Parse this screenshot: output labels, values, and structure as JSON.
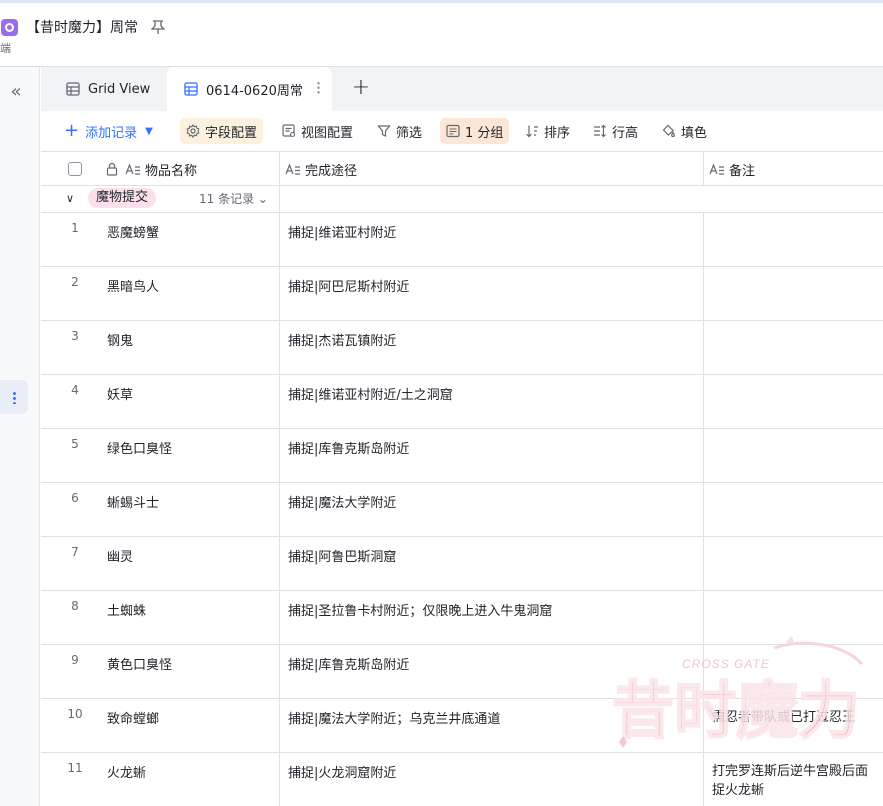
{
  "app": {
    "title": "【昔时魔力】周常",
    "subtitle": "端"
  },
  "tabs": [
    {
      "label": "Grid View",
      "active": false
    },
    {
      "label": "0614-0620周常",
      "active": true
    }
  ],
  "toolbar": {
    "add_record": "添加记录",
    "field_config": "字段配置",
    "view_config": "视图配置",
    "filter": "筛选",
    "group": "1 分组",
    "sort": "排序",
    "row_height": "行高",
    "fill_color": "填色"
  },
  "columns": {
    "name": "物品名称",
    "path": "完成途径",
    "note": "备注"
  },
  "group": {
    "label": "魔物提交",
    "count": "11 条记录"
  },
  "rows": [
    {
      "num": "1",
      "name": "恶魔螃蟹",
      "path": "捕捉|维诺亚村附近",
      "note": ""
    },
    {
      "num": "2",
      "name": "黑暗鸟人",
      "path": "捕捉|阿巴尼斯村附近",
      "note": ""
    },
    {
      "num": "3",
      "name": "钢鬼",
      "path": "捕捉|杰诺瓦镇附近",
      "note": ""
    },
    {
      "num": "4",
      "name": "妖草",
      "path": "捕捉|维诺亚村附近/土之洞窟",
      "note": ""
    },
    {
      "num": "5",
      "name": "绿色口臭怪",
      "path": "捕捉|库鲁克斯岛附近",
      "note": ""
    },
    {
      "num": "6",
      "name": "蜥蜴斗士",
      "path": "捕捉|魔法大学附近",
      "note": ""
    },
    {
      "num": "7",
      "name": "幽灵",
      "path": "捕捉|阿鲁巴斯洞窟",
      "note": ""
    },
    {
      "num": "8",
      "name": "土蜘蛛",
      "path": "捕捉|圣拉鲁卡村附近；仅限晚上进入牛鬼洞窟",
      "note": ""
    },
    {
      "num": "9",
      "name": "黄色口臭怪",
      "path": "捕捉|库鲁克斯岛附近",
      "note": ""
    },
    {
      "num": "10",
      "name": "致命螳螂",
      "path": "捕捉|魔法大学附近；乌克兰井底通道",
      "note": "需忍者带队或已打过忍王"
    },
    {
      "num": "11",
      "name": "火龙蜥",
      "path": "捕捉|火龙洞窟附近",
      "note": "打完罗连斯后逆牛宫殿后面捉火龙蜥"
    }
  ],
  "watermark": {
    "main": "昔时魔力",
    "small": "CROSS GATE"
  },
  "colors": {
    "accent": "#3370ff",
    "app_icon": "#9b6cf0",
    "group_tag": "#fbe0ea",
    "field_config_bg": "#fcf1df",
    "group_bg": "#fbe6d7"
  }
}
